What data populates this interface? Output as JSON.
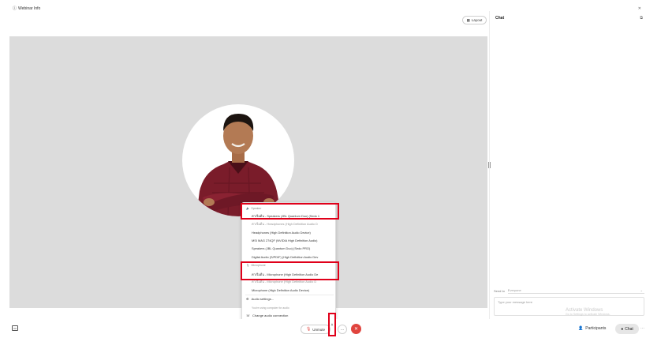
{
  "header": {
    "webinar_info": "Webinar Info",
    "layout_label": "Layout"
  },
  "chat": {
    "title": "Chat",
    "send_to_label": "Send to",
    "send_to_value": "Everyone",
    "input_placeholder": "Type your message here",
    "watermark_title": "Activate Windows",
    "watermark_sub": "Go to Settings to activate Windows."
  },
  "audio_menu": {
    "speaker_section": "Speaker",
    "speakers": [
      "ค่าเริ่มต้น - Speakers (JBL Quantum Duo) (Sedo 1",
      "ค่าเริ่มต้น - Headphones (High Definition Audio D",
      "Headphones (High Definition Audio Device)",
      "MSI MAG 274QF (NVIDIA High Definition Audio)",
      "Speakers (JBL Quantum Duo) (Sedo PRO)",
      "Digital Audio (S/PDIF) (High Definition Audio Dev"
    ],
    "microphone_section": "Microphone",
    "microphones": [
      "ค่าเริ่มต้น - Microphone (High Definition Audio De",
      "ค่าเริ่มต้น - Microphone (High Definition Audio D",
      "Microphone (High Definition Audio Device)"
    ],
    "audio_settings": "Audio settings...",
    "using_computer_note": "You're using computer for audio",
    "change_connection": "Change audio connection"
  },
  "controls": {
    "unmute_label": "Unmute",
    "participants_label": "Participants",
    "chat_label": "Chat"
  },
  "colors": {
    "highlight": "#e0001a",
    "leave": "#e0443e",
    "stage_bg": "#dcdcdc"
  }
}
